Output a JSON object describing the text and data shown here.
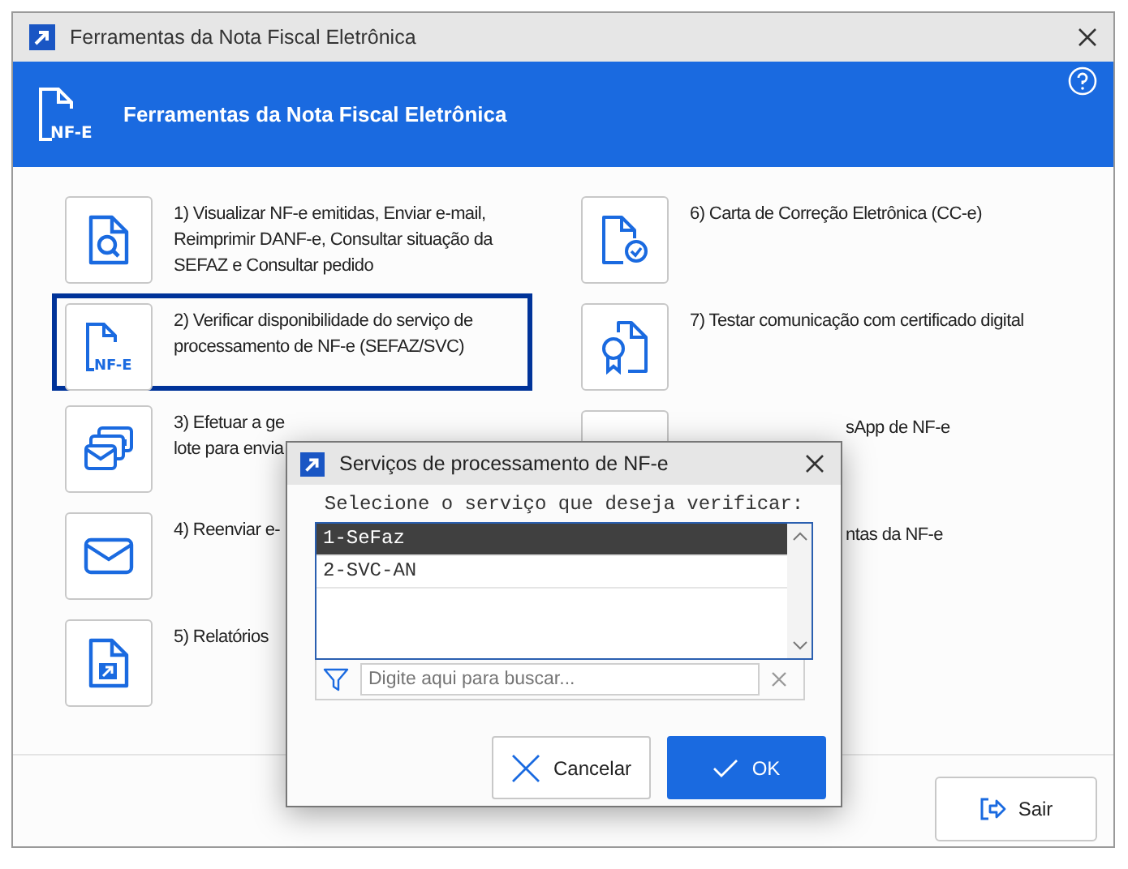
{
  "window": {
    "title": "Ferramentas da Nota Fiscal Eletrônica"
  },
  "header": {
    "title": "Ferramentas da Nota Fiscal Eletrônica",
    "logo_text": "NF-E"
  },
  "tools": [
    {
      "kind": "search-doc",
      "text": "1) Visualizar NF-e emitidas, Enviar e-mail, Reimprimir DANF-e, Consultar situação da SEFAZ e Consultar pedido",
      "selected": false
    },
    {
      "kind": "nfe",
      "icon_text": "NF-E",
      "text": "2) Verificar disponibilidade do serviço de processamento de NF-e (SEFAZ/SVC)",
      "selected": true
    },
    {
      "kind": "mail-cards",
      "text": "3) Efetuar a ge",
      "text_2": "lote para envia",
      "selected": false
    },
    {
      "kind": "mail",
      "text": "4) Reenviar e-",
      "selected": false
    },
    {
      "kind": "report",
      "text": "5) Relatórios",
      "selected": false
    },
    {
      "kind": "check-doc",
      "text": "6) Carta de Correção Eletrônica (CC-e)",
      "selected": false
    },
    {
      "kind": "certificate",
      "text": "7) Testar comunicação com certificado digital",
      "selected": false
    },
    {
      "text": "sApp de NF-e",
      "selected": false
    },
    {
      "text": "ntas da NF-e",
      "selected": false
    }
  ],
  "exit_button": {
    "label": "Sair"
  },
  "dialog": {
    "title": "Serviços de processamento de NF-e",
    "prompt": "Selecione o serviço que deseja verificar:",
    "options": [
      {
        "label": "1-SeFaz",
        "selected": true
      },
      {
        "label": "2-SVC-AN",
        "selected": false
      }
    ],
    "search": {
      "placeholder": "Digite aqui para buscar..."
    },
    "buttons": [
      {
        "kind": "cancel",
        "label": "Cancelar"
      },
      {
        "kind": "ok",
        "label": "OK"
      }
    ]
  }
}
